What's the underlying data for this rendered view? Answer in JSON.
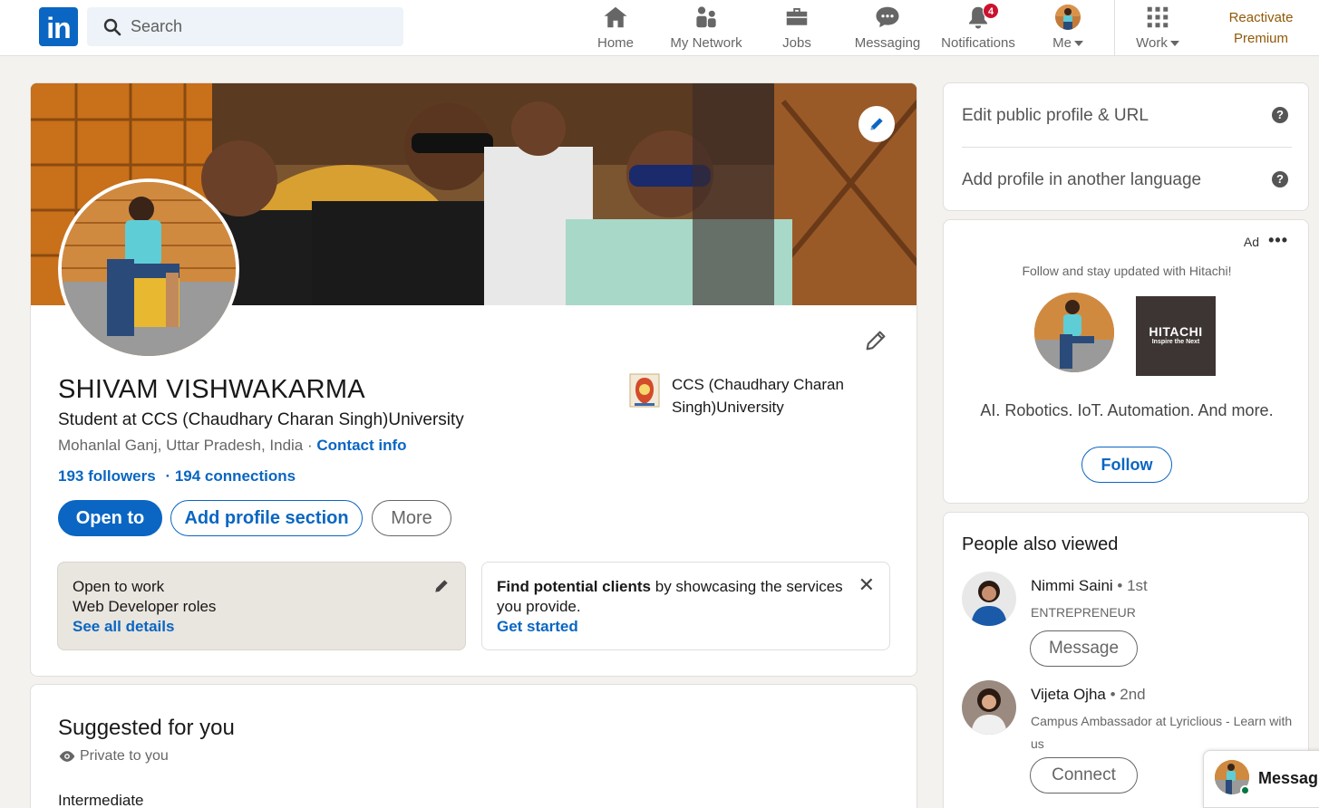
{
  "nav": {
    "search_placeholder": "Search",
    "items": [
      {
        "label": "Home",
        "icon": "home-icon"
      },
      {
        "label": "My Network",
        "icon": "network-icon"
      },
      {
        "label": "Jobs",
        "icon": "briefcase-icon"
      },
      {
        "label": "Messaging",
        "icon": "messaging-icon"
      },
      {
        "label": "Notifications",
        "icon": "bell-icon",
        "badge": "4"
      },
      {
        "label": "Me",
        "icon": "avatar"
      },
      {
        "label": "Work",
        "icon": "grid-icon"
      }
    ],
    "premium_line1": "Reactivate",
    "premium_line2": "Premium",
    "brand_color": "#0a66c2"
  },
  "profile": {
    "name": "SHIVAM VISHWAKARMA",
    "headline": "Student at CCS (Chaudhary Charan Singh)University",
    "location": "Mohanlal Ganj, Uttar Pradesh, India",
    "location_sep": " · ",
    "contact_info": "Contact info",
    "followers": "193 followers",
    "connections": "· 194 connections",
    "education": "CCS (Chaudhary Charan Singh)University",
    "buttons": {
      "open_to": "Open to",
      "add_section": "Add profile section",
      "more": "More"
    },
    "open_to_work": {
      "title": "Open to work",
      "roles": "Web Developer roles",
      "link": "See all details"
    },
    "clients": {
      "bold": "Find potential clients",
      "rest": " by showcasing the services you provide.",
      "link": "Get started"
    }
  },
  "suggested": {
    "title": "Suggested for you",
    "privacy": "Private to you",
    "level": "Intermediate"
  },
  "right": {
    "edit_public": "Edit public profile & URL",
    "add_language": "Add profile in another language",
    "help": "?",
    "ad": {
      "label": "Ad",
      "menu": "•••",
      "tagline": "Follow and stay updated with Hitachi!",
      "company": "HITACHI",
      "company_sub": "Inspire the Next",
      "slogan": "AI. Robotics. IoT. Automation. And more.",
      "follow": "Follow"
    },
    "people_title": "People also viewed",
    "people": [
      {
        "name": "Nimmi Saini",
        "degree": " • 1st",
        "title": "ENTREPRENEUR",
        "button": "Message"
      },
      {
        "name": "Vijeta Ojha",
        "degree": " • 2nd",
        "title": "Campus Ambassador at Lyriclious - Learn with us",
        "button": "Connect"
      }
    ]
  },
  "messaging_float": {
    "label": "Messaging"
  }
}
